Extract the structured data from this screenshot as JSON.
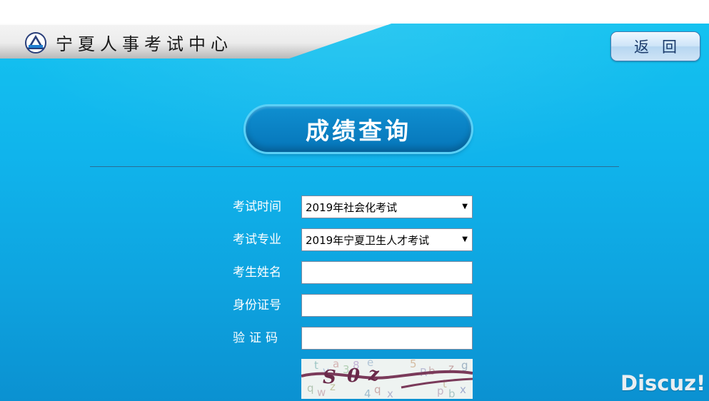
{
  "header": {
    "site_title": "宁夏人事考试中心",
    "back_label": "返回"
  },
  "page_title": "成绩查询",
  "form": {
    "fields": [
      {
        "label": "考试时间",
        "type": "select",
        "value": "2019年社会化考试"
      },
      {
        "label": "考试专业",
        "type": "select",
        "value": "2019年宁夏卫生人才考试"
      },
      {
        "label": "考生姓名",
        "type": "text",
        "value": ""
      },
      {
        "label": "身份证号",
        "type": "text",
        "value": ""
      },
      {
        "label": "验证码",
        "type": "text",
        "value": ""
      }
    ]
  },
  "watermark": "Discuz!",
  "colors": {
    "background_top": "#14c2f0",
    "background_bottom": "#0b91d1",
    "title_pill": "#0675b9",
    "label_text": "#ffffff",
    "button_text": "#1a3a6a"
  },
  "icons": {
    "logo": "triangle-emblem-icon",
    "select_arrow": "triangle-down-icon"
  }
}
